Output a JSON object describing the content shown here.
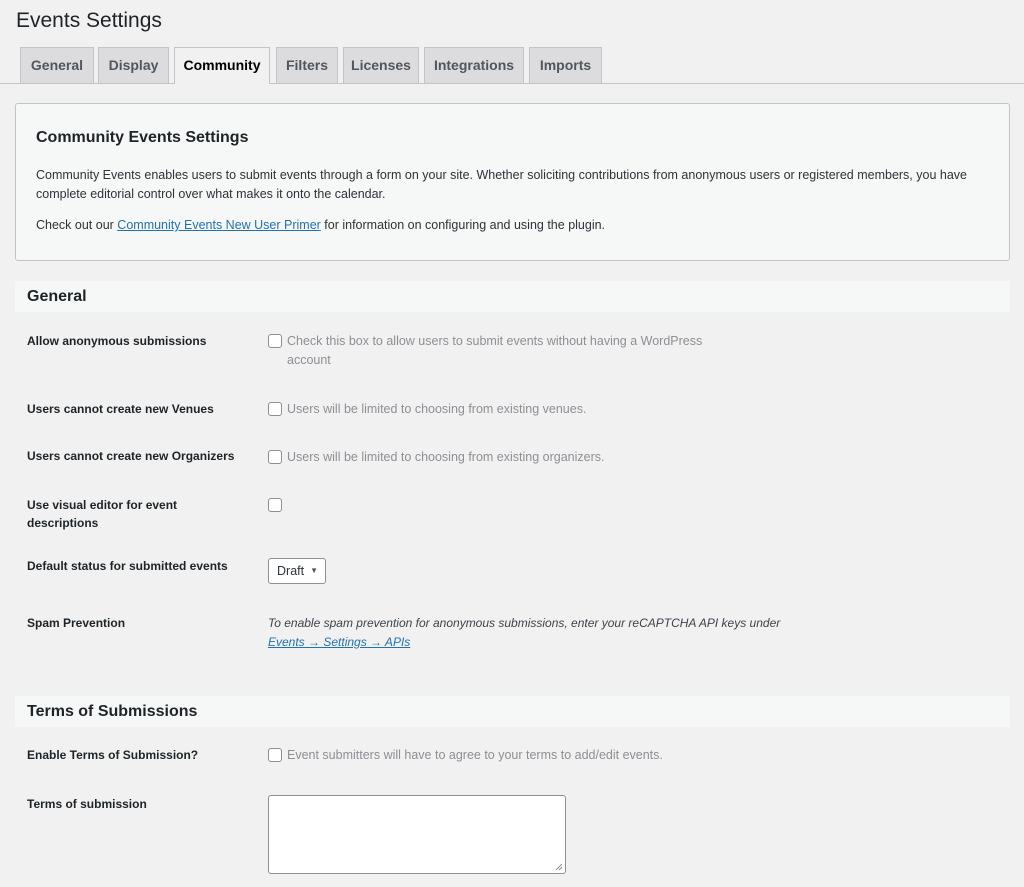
{
  "page_title": "Events Settings",
  "tabs": [
    {
      "label": "General"
    },
    {
      "label": "Display"
    },
    {
      "label": "Community"
    },
    {
      "label": "Filters"
    },
    {
      "label": "Licenses"
    },
    {
      "label": "Integrations"
    },
    {
      "label": "Imports"
    }
  ],
  "active_tab": "Community",
  "intro": {
    "title": "Community Events Settings",
    "paragraph": "Community Events enables users to submit events through a form on your site. Whether soliciting contributions from anonymous users or registered members, you have complete editorial control over what makes it onto the calendar.",
    "check_out_prefix": "Check out our ",
    "link_text": "Community Events New User Primer",
    "check_out_suffix": " for information on configuring and using the plugin."
  },
  "general_section": {
    "title": "General",
    "anonymous": {
      "label": "Allow anonymous submissions",
      "description": "Check this box to allow users to submit events without having a WordPress account"
    },
    "venues": {
      "label": "Users cannot create new Venues",
      "description": "Users will be limited to choosing from existing venues."
    },
    "organizers": {
      "label": "Users cannot create new Organizers",
      "description": "Users will be limited to choosing from existing organizers."
    },
    "visual_editor": {
      "label": "Use visual editor for event descriptions"
    },
    "default_status": {
      "label": "Default status for submitted events",
      "value": "Draft"
    },
    "spam": {
      "label": "Spam Prevention",
      "text": "To enable spam prevention for anonymous submissions, enter your reCAPTCHA API keys under ",
      "link_text": "Events → Settings → APIs"
    }
  },
  "terms_section": {
    "title": "Terms of Submissions",
    "enable": {
      "label": "Enable Terms of Submission?",
      "description": "Event submitters will have to agree to your terms to add/edit events."
    },
    "terms": {
      "label": "Terms of submission"
    }
  },
  "colors": {
    "link": "#2271b1",
    "background": "#f1f1f1",
    "panel": "#f6f7f7"
  }
}
